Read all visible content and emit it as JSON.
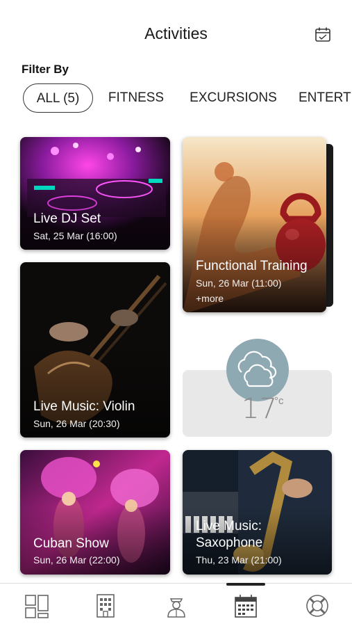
{
  "header": {
    "title": "Activities",
    "calendar_icon": "calendar-icon"
  },
  "filter": {
    "label": "Filter By",
    "chips": [
      "ALL (5)",
      "FITNESS",
      "EXCURSIONS",
      "ENTERT"
    ],
    "selected": "ALL (5)"
  },
  "activities": [
    {
      "title": "Live DJ Set",
      "date": "Sat, 25 Mar (16:00)"
    },
    {
      "title": "Functional Training",
      "date": "Sun, 26 Mar (11:00)",
      "more": "+more"
    },
    {
      "title": "Live Music: Violin",
      "date": "Sun, 26 Mar (20:30)"
    },
    {
      "title_line1": "Live Music:",
      "title_line2": "Saxophone",
      "date": "Thu, 23 Mar (21:00)"
    },
    {
      "title": "Cuban Show",
      "date": "Sun, 26 Mar (22:00)"
    }
  ],
  "weather": {
    "temperature": "17",
    "unit": "°c",
    "icon": "cloud-icon"
  },
  "tabbar": {
    "items": [
      "dashboard-icon",
      "hotel-icon",
      "concierge-icon",
      "calendar-icon",
      "lifebuoy-icon"
    ],
    "active": "calendar-icon"
  },
  "colors": {
    "weather_bubble": "#8ea9b2",
    "weather_card": "#e8e8e8"
  }
}
